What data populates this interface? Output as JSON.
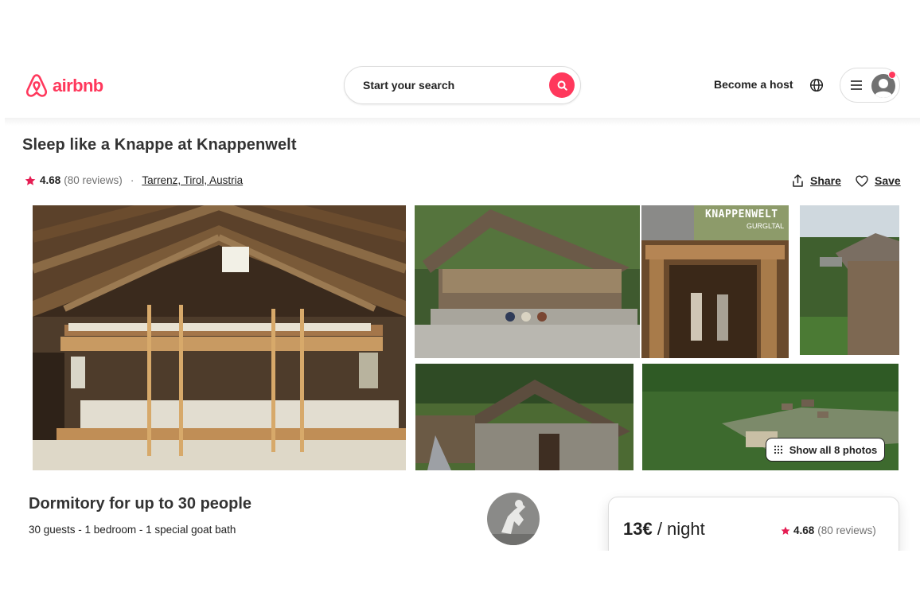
{
  "header": {
    "logo_text": "airbnb",
    "search_label": "Start your search",
    "become_host": "Become a host",
    "brand_color": "#ff385c"
  },
  "listing": {
    "title": "Sleep like a Knappe at Knappenwelt",
    "rating": "4.68",
    "reviews": "(80 reviews)",
    "separator": "·",
    "location": "Tarrenz, Tirol, Austria",
    "share_label": "Share",
    "save_label": "Save"
  },
  "photos": {
    "sign_title": "KNAPPENWELT",
    "sign_sub": "GURGLTAL",
    "show_all": "Show all 8 photos"
  },
  "details": {
    "room_title": "Dormitory for up to 30 people",
    "room_summary": "30 guests - 1 bedroom - 1 special goat bath"
  },
  "booking": {
    "price": "13€",
    "price_unit": " / night",
    "rating": "4.68",
    "reviews": "(80 reviews)"
  },
  "icons": [
    "airbnb-logo-icon",
    "search-icon",
    "globe-icon",
    "menu-icon",
    "user-avatar-icon",
    "star-icon",
    "share-icon",
    "heart-icon",
    "grid-icon"
  ]
}
